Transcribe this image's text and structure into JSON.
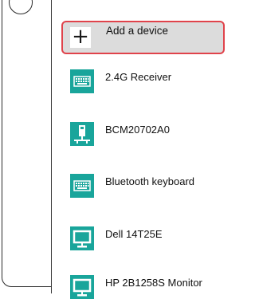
{
  "add_device": {
    "label": "Add a device",
    "icon": "plus-icon"
  },
  "devices": [
    {
      "name": "2.4G Receiver",
      "icon": "keyboard-icon"
    },
    {
      "name": "BCM20702A0",
      "icon": "usb-device-icon"
    },
    {
      "name": "Bluetooth keyboard",
      "icon": "keyboard-icon"
    },
    {
      "name": "Dell 14T25E",
      "icon": "monitor-icon"
    },
    {
      "name": "HP 2B1258S Monitor",
      "icon": "monitor-icon"
    }
  ],
  "colors": {
    "icon_bg": "#19a59b",
    "highlight_border": "#e0434b",
    "highlight_bg": "#dcdcdc"
  }
}
